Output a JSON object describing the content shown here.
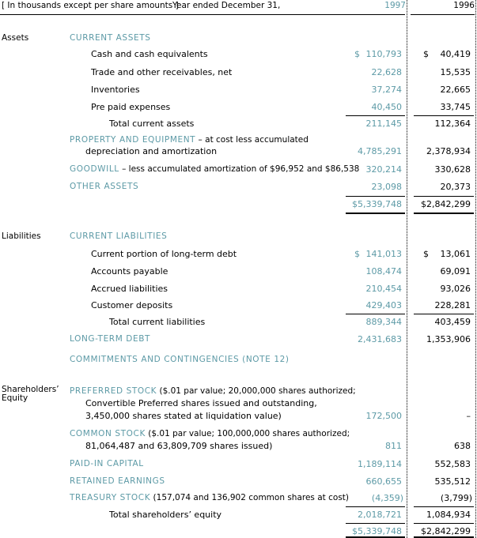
{
  "header": {
    "units_note": "[ In thousands except per share amounts ]",
    "period": "Year ended December 31,",
    "year_current": "1997",
    "year_prior": "1996"
  },
  "margin_labels": {
    "assets": "Assets",
    "liabilities": "Liabilities",
    "equity_line1": "Shareholders’",
    "equity_line2": "Equity"
  },
  "colors": {
    "accent_teal": "#5d9aa6",
    "text_black": "#000000",
    "rule": "#000000"
  },
  "symbols": {
    "dollar": "$",
    "dash": "–"
  },
  "rows": [
    {
      "id": "current-assets-head",
      "kind": "section",
      "label_lead": "CURRENT ASSETS",
      "label_tail": "",
      "v1997": "",
      "v1996": ""
    },
    {
      "id": "cash-and-cash-equivalents",
      "kind": "item",
      "label": "Cash and cash equivalents",
      "v1997": "110,793",
      "v1996": "40,419",
      "dollar97": "$",
      "dollar96": "$"
    },
    {
      "id": "trade-and-other-receivables-net",
      "kind": "item",
      "label": "Trade and other receivables, net",
      "v1997": "22,628",
      "v1996": "15,535"
    },
    {
      "id": "inventories",
      "kind": "item",
      "label": "Inventories",
      "v1997": "37,274",
      "v1996": "22,665"
    },
    {
      "id": "pre-paid-expenses",
      "kind": "item",
      "label": "Pre paid expenses",
      "v1997": "40,450",
      "v1996": "33,745"
    },
    {
      "id": "total-current-assets",
      "kind": "total",
      "label": "Total current assets",
      "v1997": "211,145",
      "v1996": "112,364"
    },
    {
      "id": "property-and-equipment-head",
      "kind": "section",
      "label_lead": "PROPERTY AND EQUIPMENT",
      "label_tail": " – at cost less accumulated",
      "v1997": "",
      "v1996": ""
    },
    {
      "id": "depreciation-and-amortization",
      "kind": "item-cont",
      "label": "depreciation and amortization",
      "v1997": "4,785,291",
      "v1996": "2,378,934"
    },
    {
      "id": "goodwill",
      "kind": "section",
      "label_lead": "GOODWILL",
      "label_tail": " – less accumulated  amortization of  $96,952 and $86,538",
      "v1997": "320,214",
      "v1996": "330,628"
    },
    {
      "id": "other-assets",
      "kind": "section",
      "label_lead": "OTHER ASSETS",
      "label_tail": "",
      "v1997": "23,098",
      "v1996": "20,373"
    },
    {
      "id": "total-assets",
      "kind": "grandtotal",
      "label": "",
      "v1997": "$5,339,748",
      "v1996": "$2,842,299"
    },
    {
      "id": "current-liabilities-head",
      "kind": "section",
      "label_lead": "CURRENT LIABILITIES",
      "label_tail": "",
      "v1997": "",
      "v1996": ""
    },
    {
      "id": "current-portion-of-long-term-debt",
      "kind": "item",
      "label": "Current portion of long-term debt",
      "v1997": "141,013",
      "v1996": "13,061",
      "dollar97": "$",
      "dollar96": "$"
    },
    {
      "id": "accounts-payable",
      "kind": "item",
      "label": "Accounts payable",
      "v1997": "108,474",
      "v1996": "69,091"
    },
    {
      "id": "accrued-liabilities",
      "kind": "item",
      "label": "Accrued  liabilities",
      "v1997": "210,454",
      "v1996": "93,026"
    },
    {
      "id": "customer-deposits",
      "kind": "item",
      "label": "Customer deposits",
      "v1997": "429,403",
      "v1996": "228,281"
    },
    {
      "id": "total-current-liabilities",
      "kind": "total",
      "label": "Total current liabilities",
      "v1997": "889,344",
      "v1996": "403,459"
    },
    {
      "id": "long-term-debt",
      "kind": "section",
      "label_lead": "LONG-TERM DEBT",
      "label_tail": "",
      "v1997": "2,431,683",
      "v1996": "1,353,906"
    },
    {
      "id": "commitments-and-contingencies",
      "kind": "section",
      "label_lead": "COMMITMENTS AND CONTINGENCIES (NOTE 12)",
      "label_tail": "",
      "v1997": "",
      "v1996": ""
    },
    {
      "id": "preferred-stock",
      "kind": "section",
      "label_lead": "PREFERRED STOCK",
      "label_tail": " ($.01 par value; 20,000,000 shares authorized;",
      "v1997": "",
      "v1996": ""
    },
    {
      "id": "preferred-stock-line2",
      "kind": "item-cont",
      "label": "Convertible Preferred shares issued and outstanding,",
      "v1997": "",
      "v1996": ""
    },
    {
      "id": "preferred-stock-line3",
      "kind": "item-cont",
      "label": "3,450,000 shares stated at liquidation  value)",
      "v1997": "172,500",
      "v1996": "–"
    },
    {
      "id": "common-stock",
      "kind": "section",
      "label_lead": "COMMON STOCK",
      "label_tail": " ($.01 par value; 100,000,000 shares authorized;",
      "v1997": "",
      "v1996": ""
    },
    {
      "id": "common-stock-line2",
      "kind": "item-cont",
      "label": "81,064,487 and 63,809,709 shares issued)",
      "v1997": "811",
      "v1996": "638"
    },
    {
      "id": "paid-in-capital",
      "kind": "section",
      "label_lead": "PAID-IN CAPITAL",
      "label_tail": "",
      "v1997": "1,189,114",
      "v1996": "552,583"
    },
    {
      "id": "retained-earnings",
      "kind": "section",
      "label_lead": "RETAINED EARNINGS",
      "label_tail": "",
      "v1997": "660,655",
      "v1996": "535,512"
    },
    {
      "id": "treasury-stock",
      "kind": "section",
      "label_lead": "TREASURY STOCK",
      "label_tail": " (157,074 and 136,902 common  shares at cost)",
      "v1997": "(4,359)",
      "v1996": "(3,799)"
    },
    {
      "id": "total-shareholders-equity",
      "kind": "total",
      "label": "Total shareholders’ equity",
      "v1997": "2,018,721",
      "v1996": "1,084,934"
    },
    {
      "id": "total-liabilities-and-equity",
      "kind": "grandtotal",
      "label": "",
      "v1997": "$5,339,748",
      "v1996": "$2,842,299"
    }
  ]
}
